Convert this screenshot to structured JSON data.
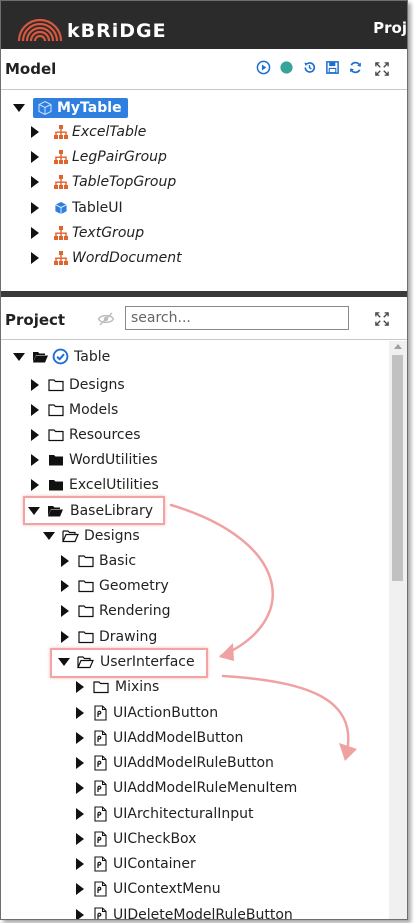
{
  "header": {
    "brand": "kBRiDGE",
    "right_text": "Proj"
  },
  "model_panel": {
    "title": "Model",
    "root": "MyTable",
    "items": [
      {
        "label": "ExcelTable",
        "icon": "hierarchy-icon",
        "italic": true
      },
      {
        "label": "LegPairGroup",
        "icon": "hierarchy-icon",
        "italic": true
      },
      {
        "label": "TableTopGroup",
        "icon": "hierarchy-icon",
        "italic": true
      },
      {
        "label": "TableUI",
        "icon": "cube-icon",
        "italic": false
      },
      {
        "label": "TextGroup",
        "icon": "hierarchy-icon",
        "italic": true
      },
      {
        "label": "WordDocument",
        "icon": "hierarchy-icon",
        "italic": true
      }
    ]
  },
  "project_panel": {
    "title": "Project",
    "search_placeholder": "search...",
    "root": "Table",
    "tree": [
      {
        "label": "Designs"
      },
      {
        "label": "Models"
      },
      {
        "label": "Resources"
      },
      {
        "label": "WordUtilities"
      },
      {
        "label": "ExcelUtilities"
      },
      {
        "label": "BaseLibrary"
      },
      {
        "label": "Designs"
      },
      {
        "label": "Basic"
      },
      {
        "label": "Geometry"
      },
      {
        "label": "Rendering"
      },
      {
        "label": "Drawing"
      },
      {
        "label": "UserInterface"
      },
      {
        "label": "Mixins"
      },
      {
        "label": "UIActionButton"
      },
      {
        "label": "UIAddModelButton"
      },
      {
        "label": "UIAddModelRuleButton"
      },
      {
        "label": "UIAddModelRuleMenuItem"
      },
      {
        "label": "UIArchitecturalInput"
      },
      {
        "label": "UICheckBox"
      },
      {
        "label": "UIContainer"
      },
      {
        "label": "UIContextMenu"
      },
      {
        "label": "UIDeleteModelRuleButton"
      }
    ]
  },
  "colors": {
    "selection": "#2f7fe0",
    "accent": "#1f6fd1",
    "highlight": "#f3a3a3",
    "header": "#2b2b2b"
  }
}
